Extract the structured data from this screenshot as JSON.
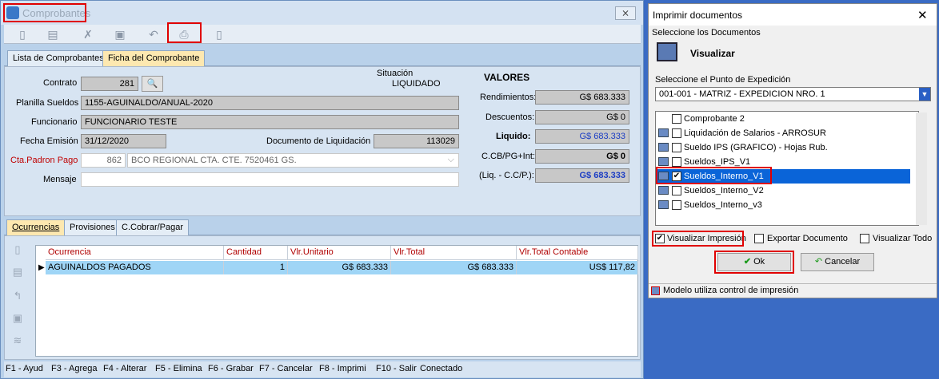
{
  "main": {
    "title": "Comprobantes",
    "close": "⨯",
    "tabs": [
      "Lista de Comprobantes",
      "Ficha del Comprobante"
    ],
    "form": {
      "contrato_label": "Contrato",
      "contrato_value": "281",
      "planilla_label": "Planilla Sueldos",
      "planilla_value": "1155-AGUINALDO/ANUAL-2020",
      "funcionario_label": "Funcionario",
      "funcionario_value": "FUNCIONARIO TESTE",
      "fecha_label": "Fecha Emisión",
      "fecha_value": "31/12/2020",
      "doc_label": "Documento de Liquidación",
      "doc_value": "113029",
      "cta_label": "Cta.Padron Pago",
      "cta_code": "862",
      "cta_value": "BCO REGIONAL CTA. CTE. 7520461 GS.",
      "mensaje_label": "Mensaje",
      "situacion_label": "Situación",
      "situacion_value": "LIQUIDADO"
    },
    "valores": {
      "title": "VALORES",
      "rend_label": "Rendimientos:",
      "rend_value": "G$ 683.333",
      "desc_label": "Descuentos:",
      "desc_value": "G$ 0",
      "liq_label": "Liquido:",
      "liq_value": "G$ 683.333",
      "ccb_label": "C.CB/PG+Int:",
      "ccb_value": "G$ 0",
      "liqcc_label": "(Liq. - C.C/P.):",
      "liqcc_value": "G$ 683.333"
    },
    "tabs2": [
      "Ocurrencias",
      "Provisiones",
      "C.Cobrar/Pagar"
    ],
    "grid": {
      "headers": [
        "Ocurrencia",
        "Cantidad",
        "Vlr.Unitario",
        "Vlr.Total",
        "Vlr.Total Contable"
      ],
      "row": [
        "AGUINALDOS PAGADOS",
        "1",
        "G$ 683.333",
        "G$ 683.333",
        "US$ 117,82"
      ]
    },
    "status": [
      "F1 - Ayud",
      "F3 - Agrega",
      "F4 - Alterar",
      "F5 - Elimina",
      "F6 - Grabar",
      "F7 - Cancelar",
      "F8 - Imprimi",
      "F10 - Salir",
      "Conectado"
    ]
  },
  "dialog": {
    "title": "Imprimir documentos",
    "select_docs": "Seleccione los Documentos",
    "visualizar": "Visualizar",
    "punto_label": "Seleccione el Punto de Expedición",
    "punto_value": "001-001 - MATRIZ - EXPEDICION NRO. 1",
    "docs": [
      "Comprobante 2",
      "Liquidación de Salarios - ARROSUR",
      "Sueldo IPS (GRAFICO) - Hojas Rub.",
      "Sueldos_IPS_V1",
      "Sueldos_Interno_V1",
      "Sueldos_Interno_V2",
      "Sueldos_Interno_v3"
    ],
    "vis_imp": "Visualizar Impresión",
    "exportar": "Exportar Documento",
    "vis_todo": "Visualizar Todo",
    "ok": "Ok",
    "cancelar": "Cancelar",
    "footer": "Modelo utiliza control de impresión"
  }
}
